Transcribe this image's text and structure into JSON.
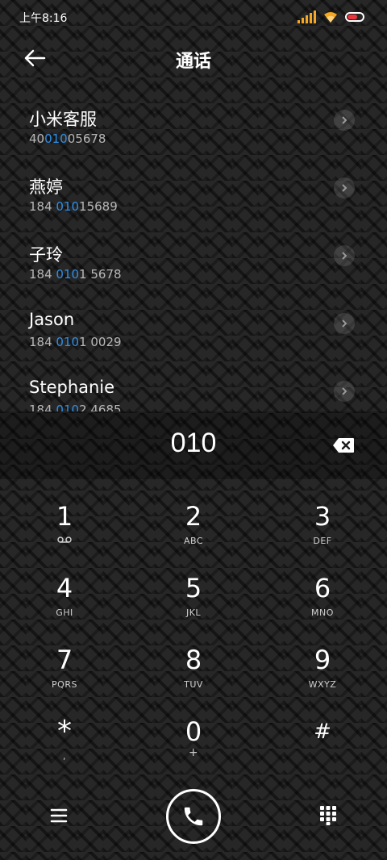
{
  "status_bar": {
    "time": "上午8:16"
  },
  "header": {
    "title": "通话"
  },
  "contacts": [
    {
      "name": "小米客服",
      "number_pre": "40",
      "number_match": "010",
      "number_post": "05678"
    },
    {
      "name": "燕婷",
      "number_pre": "184 ",
      "number_match": "010",
      "number_post": "15689"
    },
    {
      "name": "子玲",
      "number_pre": "184 ",
      "number_match": "010",
      "number_post": "1 5678"
    },
    {
      "name": "Jason",
      "number_pre": "184 ",
      "number_match": "010",
      "number_post": "1 0029"
    },
    {
      "name": "Stephanie",
      "number_pre": "184 ",
      "number_match": "010",
      "number_post": "2 4685"
    }
  ],
  "dialer": {
    "number": "010"
  },
  "keypad": [
    {
      "digit": "1",
      "letters": ""
    },
    {
      "digit": "2",
      "letters": "ABC"
    },
    {
      "digit": "3",
      "letters": "DEF"
    },
    {
      "digit": "4",
      "letters": "GHI"
    },
    {
      "digit": "5",
      "letters": "JKL"
    },
    {
      "digit": "6",
      "letters": "MNO"
    },
    {
      "digit": "7",
      "letters": "PQRS"
    },
    {
      "digit": "8",
      "letters": "TUV"
    },
    {
      "digit": "9",
      "letters": "WXYZ"
    },
    {
      "digit": "*",
      "letters": ","
    },
    {
      "digit": "0",
      "letters": "+"
    },
    {
      "digit": "#",
      "letters": ""
    }
  ],
  "colors": {
    "highlight": "#2e8fe8",
    "signal": "#f5a623",
    "battery": "#e8353d"
  },
  "icons": {
    "back": "arrow-left-icon",
    "detail": "chevron-right-icon",
    "backspace": "backspace-icon",
    "voicemail": "voicemail-icon",
    "menu": "menu-icon",
    "call": "phone-icon",
    "dialpad": "dialpad-icon"
  }
}
